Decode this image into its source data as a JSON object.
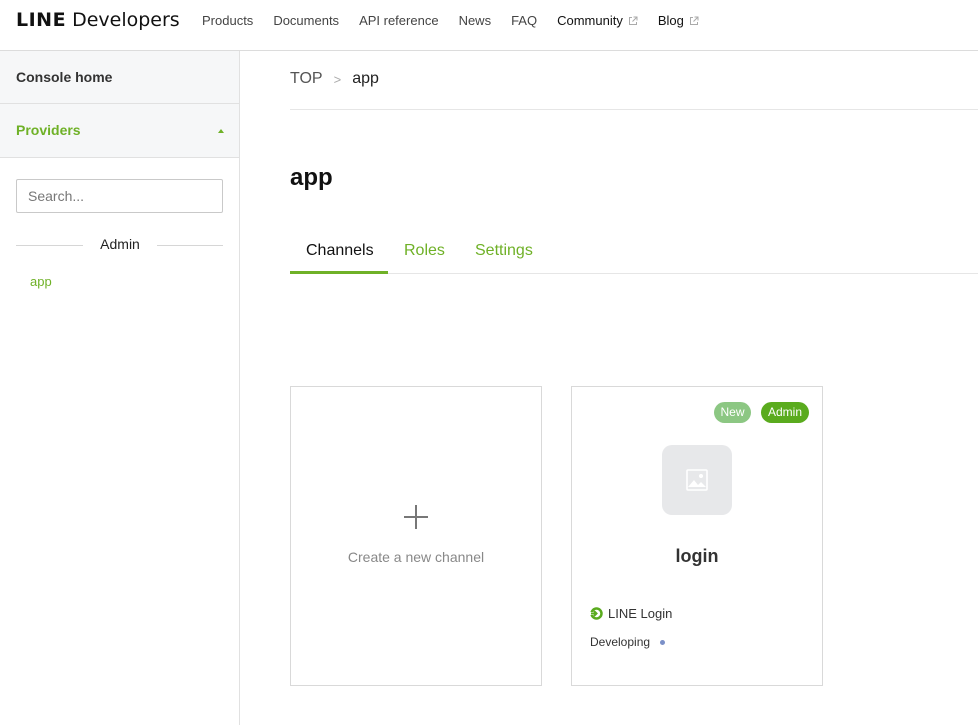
{
  "header": {
    "logo_line": "LINE",
    "logo_developers": "Developers",
    "nav": [
      {
        "label": "Products",
        "external": false
      },
      {
        "label": "Documents",
        "external": false
      },
      {
        "label": "API reference",
        "external": false
      },
      {
        "label": "News",
        "external": false
      },
      {
        "label": "FAQ",
        "external": false
      },
      {
        "label": "Community",
        "external": true
      },
      {
        "label": "Blog",
        "external": true
      }
    ]
  },
  "sidebar": {
    "console_home": "Console home",
    "providers": "Providers",
    "search_placeholder": "Search...",
    "group_label": "Admin",
    "provider_items": [
      "app"
    ]
  },
  "breadcrumb": {
    "root": "TOP",
    "separator": ">",
    "current": "app"
  },
  "page_title": "app",
  "tabs": [
    {
      "label": "Channels",
      "active": true
    },
    {
      "label": "Roles",
      "active": false
    },
    {
      "label": "Settings",
      "active": false
    }
  ],
  "create_card": {
    "label": "Create a new channel"
  },
  "channel_card": {
    "badges": [
      "New",
      "Admin"
    ],
    "name": "login",
    "type": "LINE Login",
    "status": "Developing"
  },
  "colors": {
    "accent": "#6fb127",
    "badge_new": "#8cc783",
    "badge_admin": "#5aab1e",
    "status_dot": "#7b90c8"
  }
}
